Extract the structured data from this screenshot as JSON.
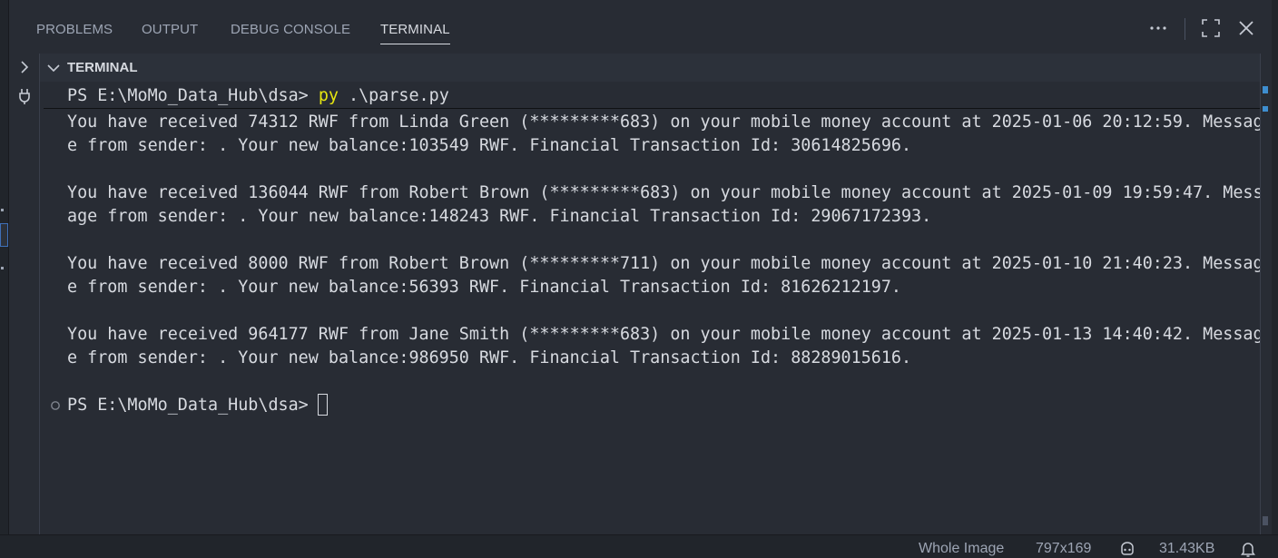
{
  "panel": {
    "tabs": [
      {
        "label": "PROBLEMS"
      },
      {
        "label": "OUTPUT"
      },
      {
        "label": "DEBUG CONSOLE"
      },
      {
        "label": "TERMINAL"
      }
    ],
    "actions": [
      "more-actions-icon",
      "maximize-panel-icon",
      "close-icon"
    ]
  },
  "terminal": {
    "section_title": "TERMINAL",
    "prompt": "PS E:\\MoMo_Data_Hub\\dsa> ",
    "command_exe": "py",
    "command_args": " .\\parse.py",
    "output_lines": [
      "You have received 74312 RWF from Linda Green (*********683) on your mobile money account at 2025-01-06 20:12:59. Messag",
      "e from sender: . Your new balance:103549 RWF. Financial Transaction Id: 30614825696.",
      "",
      "You have received 136044 RWF from Robert Brown (*********683) on your mobile money account at 2025-01-09 19:59:47. Mess",
      "age from sender: . Your new balance:148243 RWF. Financial Transaction Id: 29067172393.",
      "",
      "You have received 8000 RWF from Robert Brown (*********711) on your mobile money account at 2025-01-10 21:40:23. Messag",
      "e from sender: . Your new balance:56393 RWF. Financial Transaction Id: 81626212197.",
      "",
      "You have received 964177 RWF from Jane Smith (*********683) on your mobile money account at 2025-01-13 14:40:42. Messag",
      "e from sender: . Your new balance:986950 RWF. Financial Transaction Id: 88289015616."
    ],
    "final_prompt": "PS E:\\MoMo_Data_Hub\\dsa> "
  },
  "status_bar": {
    "image_mode": "Whole Image",
    "dimensions": "797x169",
    "file_size": "31.43KB"
  },
  "colors": {
    "background": "#282c34",
    "text": "#d7dae0",
    "command_highlight": "#e5e510",
    "accent": "#3e8ed0"
  }
}
